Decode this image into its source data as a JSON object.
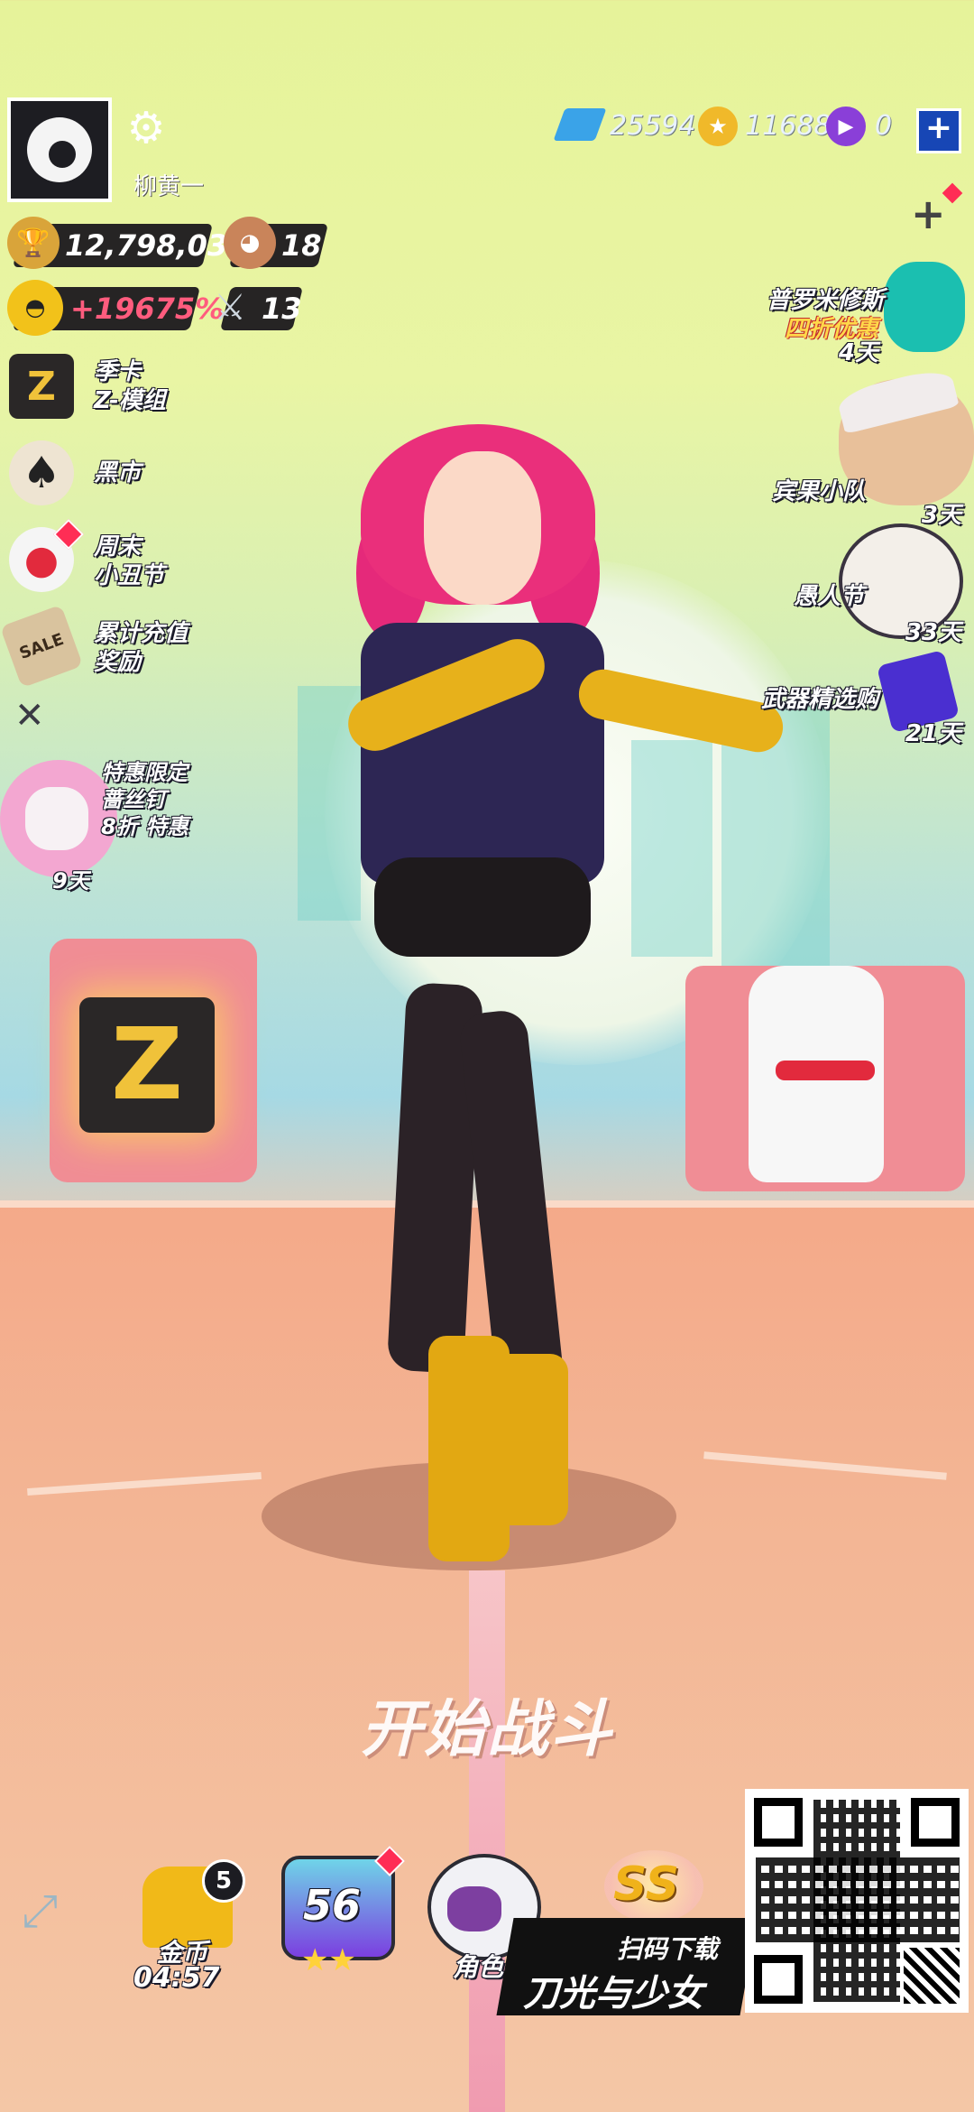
{
  "player": {
    "name": "柳黄一",
    "avatar_icon": "panda-mask-icon",
    "trophy": "12,798,036",
    "bear_count": "18",
    "bonus": "+19675%",
    "sword_count": "13"
  },
  "currency": {
    "gems": "25594",
    "coins": "116881",
    "crystals": "0"
  },
  "left_menu": [
    {
      "label_1": "季卡",
      "label_2": "Z-模组",
      "icon": "season-card-icon"
    },
    {
      "label_1": "黑市",
      "label_2": "",
      "icon": "spade-ace-icon"
    },
    {
      "label_1": "周末",
      "label_2": "小丑节",
      "icon": "clown-icon"
    },
    {
      "label_1": "累计充值",
      "label_2": "奖励",
      "icon": "sale-tag-icon"
    }
  ],
  "promo_left": {
    "line1": "特惠限定",
    "line2": "蔷丝钉",
    "line3": "8折 特惠",
    "days": "9天"
  },
  "right_menu": [
    {
      "title": "普罗米修斯",
      "sub": "四折优惠",
      "days": "4天"
    },
    {
      "title": "宾果小队",
      "sub": "",
      "days": "3天"
    },
    {
      "title": "愚人节",
      "sub": "",
      "days": "33天"
    },
    {
      "title": "武器精选购",
      "sub": "",
      "days": "21天"
    }
  ],
  "start_button": "开始战斗",
  "bottom": {
    "gold_label": "金币",
    "gold_timer": "04:57",
    "gold_badge": "5",
    "level": "56",
    "role_label": "角色",
    "rank": "SS",
    "scan_text": "扫码下载",
    "game_title": "刀光与少女"
  },
  "z_logo": "Z",
  "colors": {
    "accent_pink": "#ea2f7b",
    "accent_gold": "#e2a812",
    "bar_dark": "#262424"
  }
}
